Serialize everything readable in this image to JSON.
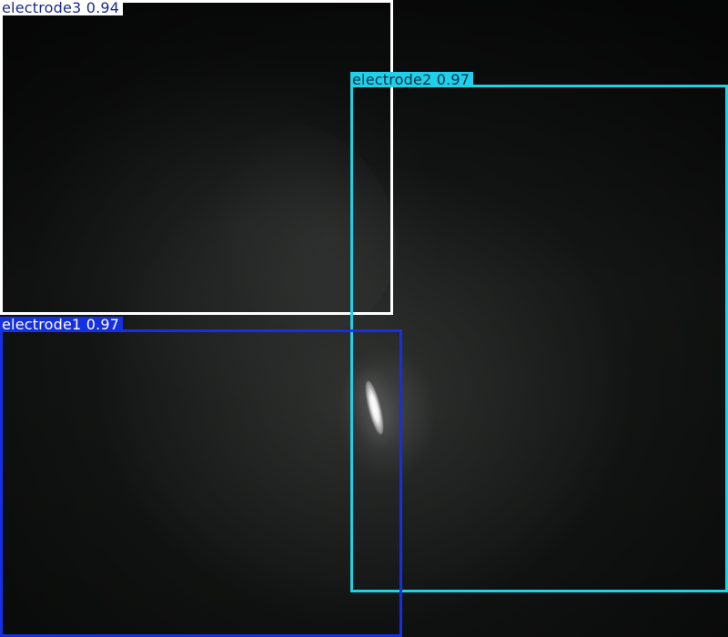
{
  "detections": [
    {
      "id": "electrode3",
      "label": "electrode3",
      "score": "0.94",
      "color": "#ffffff",
      "text_color": "#1a2a8a"
    },
    {
      "id": "electrode2",
      "label": "electrode2",
      "score": "0.97",
      "color": "#1fd0e8",
      "text_color": "#10304a"
    },
    {
      "id": "electrode1",
      "label": "electrode1",
      "score": "0.97",
      "color": "#1530e0",
      "text_color": "#ffffff"
    }
  ]
}
